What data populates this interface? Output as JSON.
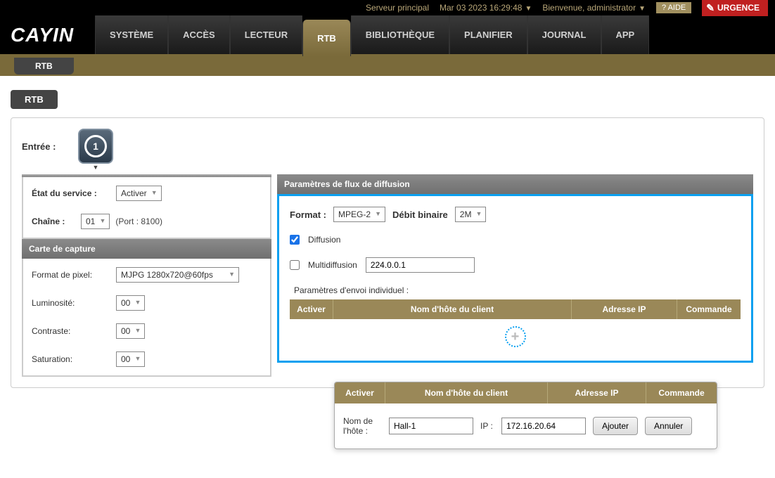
{
  "topbar": {
    "server": "Serveur principal",
    "datetime": "Mar 03 2023 16:29:48",
    "welcome": "Bienvenue, administrator",
    "help": "? AIDE",
    "urgence": "URGENCE"
  },
  "logo": "CAYIN",
  "nav": {
    "systeme": "SYSTÈME",
    "acces": "ACCÈS",
    "lecteur": "LECTEUR",
    "rtb": "RTB",
    "bibliotheque": "BIBLIOTHÈQUE",
    "planifier": "PLANIFIER",
    "journal": "JOURNAL",
    "app": "APP"
  },
  "subtab": "RTB",
  "page_title": "RTB",
  "entry": {
    "label": "Entrée :",
    "number": "1"
  },
  "left": {
    "service_header_implied": "",
    "etat_label": "État du service :",
    "etat_value": "Activer",
    "chaine_label": "Chaîne :",
    "chaine_value": "01",
    "port_text": "(Port : 8100)",
    "capture_header": "Carte de capture",
    "pixel_label": "Format de pixel:",
    "pixel_value": "MJPG 1280x720@60fps",
    "lumin_label": "Luminosité:",
    "lumin_value": "00",
    "contrast_label": "Contraste:",
    "contrast_value": "00",
    "sat_label": "Saturation:",
    "sat_value": "00"
  },
  "right": {
    "header": "Paramètres de flux de diffusion",
    "format_label": "Format :",
    "format_value": "MPEG-2",
    "bitrate_label": "Débit binaire",
    "bitrate_value": "2M",
    "diffusion_label": "Diffusion",
    "multidiffusion_label": "Multidiffusion",
    "multidiffusion_value": "224.0.0.1",
    "send_params_label": "Paramètres d'envoi individuel :",
    "th_activer": "Activer",
    "th_nom": "Nom d'hôte du client",
    "th_ip": "Adresse IP",
    "th_cmd": "Commande"
  },
  "popup": {
    "th_activer": "Activer",
    "th_nom": "Nom d'hôte du client",
    "th_ip": "Adresse IP",
    "th_cmd": "Commande",
    "host_label": "Nom de l'hôte :",
    "host_value": "Hall-1",
    "ip_label": "IP :",
    "ip_value": "172.16.20.64",
    "add_btn": "Ajouter",
    "cancel_btn": "Annuler"
  }
}
